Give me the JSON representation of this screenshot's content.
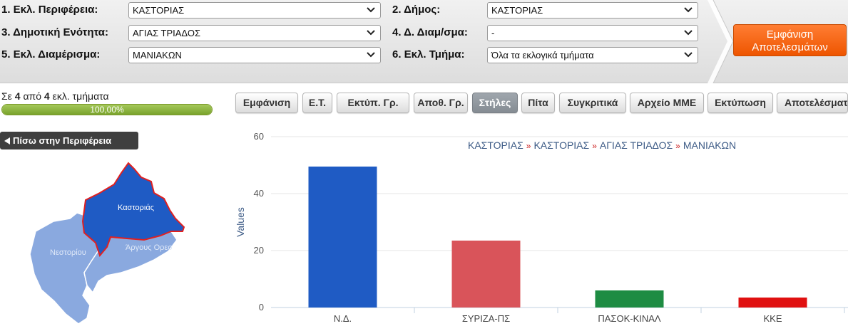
{
  "filters": [
    {
      "label": "1. Εκλ. Περιφέρεια:",
      "value": "ΚΑΣΤΟΡΙΑΣ"
    },
    {
      "label": "2. Δήμος:",
      "value": "ΚΑΣΤΟΡΙΑΣ"
    },
    {
      "label": "3. Δημοτική Ενότητα:",
      "value": "ΑΓΙΑΣ ΤΡΙΑΔΟΣ"
    },
    {
      "label": "4. Δ. Διαμ/σμα:",
      "value": "-"
    },
    {
      "label": "5. Εκλ. Διαμέρισμα:",
      "value": "ΜΑΝΙΑΚΩΝ"
    },
    {
      "label": "6. Εκλ. Τμήμα:",
      "value": "Όλα τα εκλογικά τμήματα"
    }
  ],
  "show_results": {
    "line1": "Εμφάνιση",
    "line2": "Αποτελεσμάτων"
  },
  "status": {
    "prefix": "Σε",
    "count": "4",
    "middle": "από",
    "total": "4",
    "suffix": "εκλ. τμήματα"
  },
  "progress": {
    "value": 1.0,
    "label": "100,00%"
  },
  "toolbar": [
    "Εμφάνιση",
    "Ε.Τ.",
    "Εκτύπ. Γρ.",
    "Αποθ. Γρ.",
    "Στήλες",
    "Πίτα",
    "Συγκριτικά",
    "Αρχείο ΜΜΕ",
    "Εκτύπωση",
    "Αποτελέσματα"
  ],
  "toolbar_active": "Στήλες",
  "back_button": "Πίσω στην Περιφέρεια",
  "map": {
    "regions": [
      {
        "name": "Καστοριάς",
        "selected": true
      },
      {
        "name": "Νεστορίου",
        "selected": false
      },
      {
        "name": "Άργους Ορεστικού",
        "selected": false
      }
    ],
    "labels": {
      "kastoria": "Καστοριάς",
      "nestoriou": "Νεστορίου",
      "argous": "Άργους Ορεσ"
    }
  },
  "breadcrumb": [
    "ΚΑΣΤΟΡΙΑΣ",
    "ΚΑΣΤΟΡΙΑΣ",
    "ΑΓΙΑΣ ΤΡΙΑΔΟΣ",
    "ΜΑΝΙΑΚΩΝ"
  ],
  "breadcrumb_separator": "»",
  "chart_data": {
    "type": "bar",
    "categories": [
      "Ν.Δ.",
      "ΣΥΡΙΖΑ-ΠΣ",
      "ΠΑΣΟΚ-ΚΙΝΑΛ",
      "ΚΚΕ"
    ],
    "values": [
      49.5,
      23.5,
      6,
      3.5
    ],
    "colors": [
      "#1f5bc4",
      "#d9545a",
      "#1e8c43",
      "#e01010"
    ],
    "ylabel": "Values",
    "xlabel": "",
    "ylim": [
      0,
      60
    ],
    "yticks": [
      0,
      20,
      40,
      60
    ],
    "grid": true
  }
}
